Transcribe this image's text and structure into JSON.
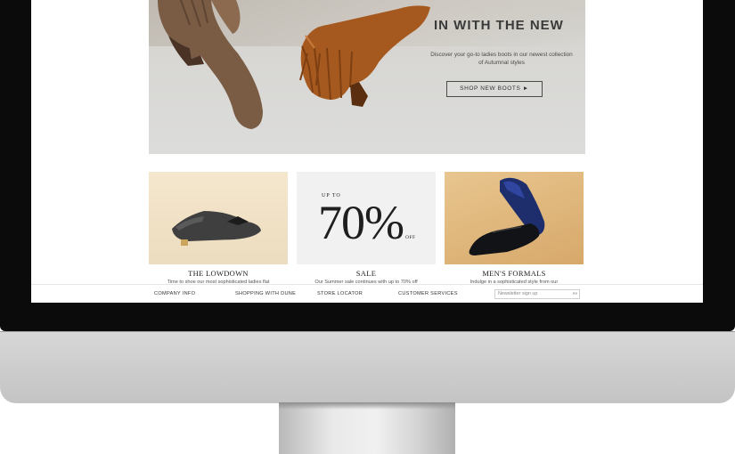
{
  "hero": {
    "title": "IN WITH THE NEW",
    "description": "Discover your go-to ladies boots in our newest collection of Autumnal styles",
    "button_label": "SHOP NEW BOOTS ►"
  },
  "tiles": [
    {
      "caption": "THE LOWDOWN",
      "text": "Time to shoe our most sophisticated ladies flat"
    },
    {
      "caption": "SALE",
      "text": "Our Summer sale continues with up to 70% off",
      "up_to": "UP TO",
      "percent": "70%",
      "off": "OFF"
    },
    {
      "caption": "MEN'S FORMALS",
      "text": "Indulge in a sophisticated style from our"
    }
  ],
  "footer": {
    "links": [
      "COMPANY INFO",
      "SHOPPING WITH DUNE",
      "STORE LOCATOR",
      "CUSTOMER SERVICES"
    ],
    "newsletter_placeholder": "Newsletter sign up",
    "newsletter_go": "»»"
  },
  "colors": {
    "bezel": "#0b0b0c",
    "chin": "#cfcfcf",
    "boot_brown": "#a5591f",
    "boot_taupe": "#7a5b43"
  }
}
